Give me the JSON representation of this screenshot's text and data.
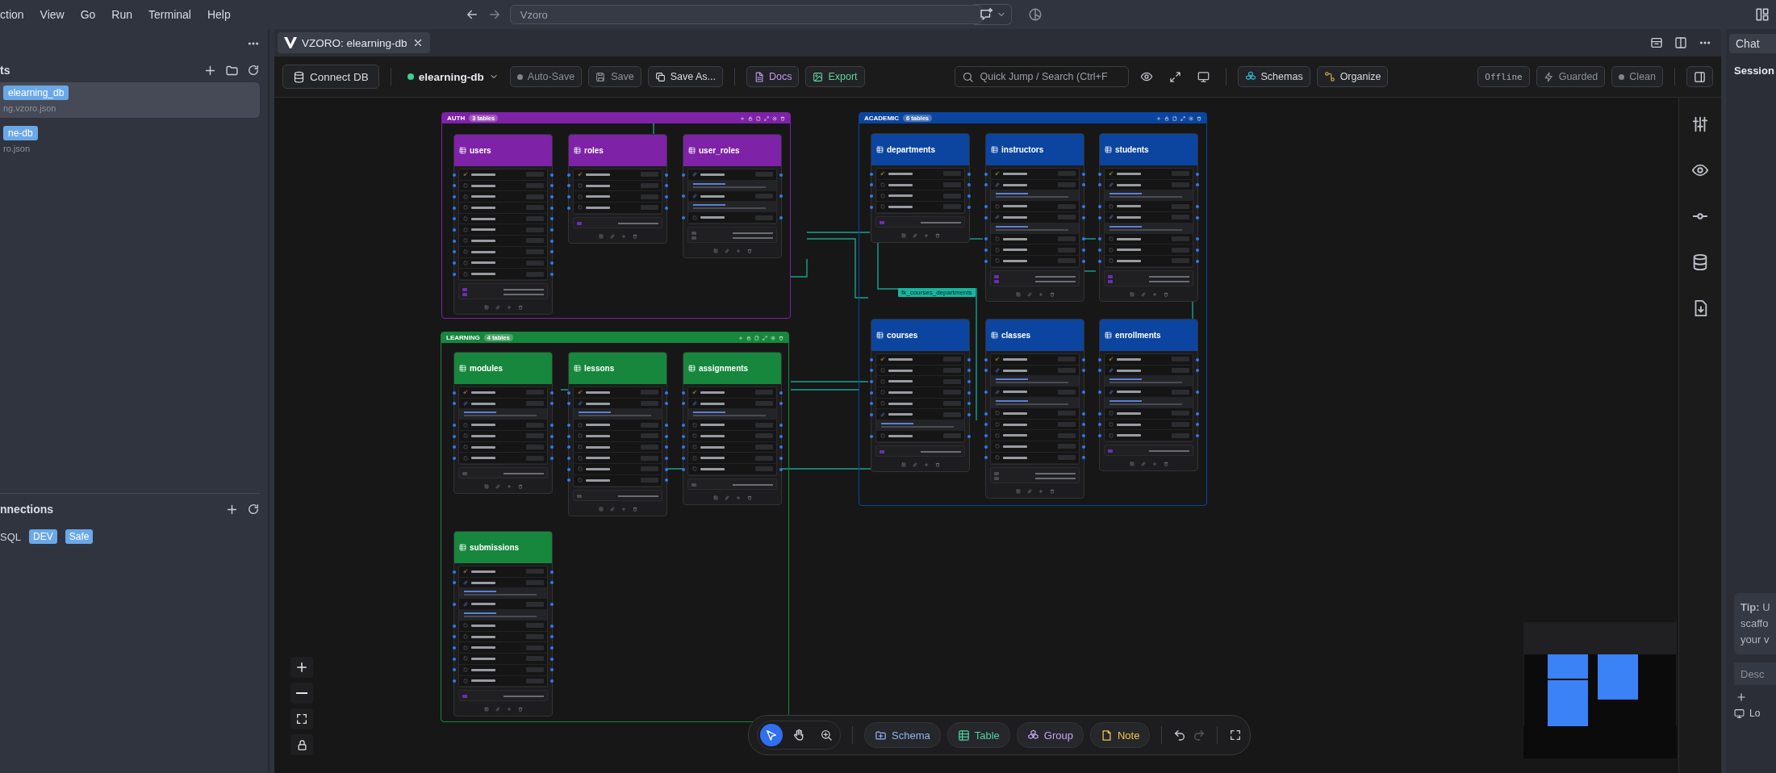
{
  "menu": [
    "ction",
    "View",
    "Go",
    "Run",
    "Terminal",
    "Help"
  ],
  "command_center": {
    "value": "Vzoro"
  },
  "sidebar": {
    "section_title": "ts",
    "projects": [
      {
        "name": "elearning_db",
        "file": "ng.vzoro.json",
        "selected": true
      },
      {
        "name": "ne-db",
        "file": "ro.json",
        "selected": false
      }
    ],
    "connections_title": "nnections",
    "connections": [
      {
        "name": "SQL",
        "tags": [
          "DEV",
          "Safe"
        ]
      }
    ]
  },
  "editor_tab": {
    "title": "VZORO: elearning-db"
  },
  "toolbar": {
    "connect": "Connect DB",
    "project": "elearning-db",
    "autosave": "Auto-Save",
    "save": "Save",
    "save_as": "Save As...",
    "docs": "Docs",
    "export": "Export",
    "search_placeholder": "Quick Jump / Search (Ctrl+F",
    "schemas": "Schemas",
    "organize": "Organize",
    "mode": "Offline",
    "guard": "Guarded",
    "status": "Clean"
  },
  "canvas": {
    "groups": [
      {
        "name": "AUTH",
        "count": "3 tables",
        "color": "#7e22a8",
        "tables": [
          {
            "name": "users",
            "columns": [
              {
                "kind": "pk"
              },
              {
                "kind": "field"
              },
              {
                "kind": "field"
              },
              {
                "kind": "field"
              },
              {
                "kind": "field"
              },
              {
                "kind": "field"
              },
              {
                "kind": "field"
              },
              {
                "kind": "field"
              },
              {
                "kind": "field"
              },
              {
                "kind": "field"
              }
            ],
            "indexes": [
              {
                "kind": "unique"
              },
              {
                "kind": "unique"
              }
            ]
          },
          {
            "name": "roles",
            "columns": [
              {
                "kind": "pk"
              },
              {
                "kind": "field"
              },
              {
                "kind": "field"
              },
              {
                "kind": "field"
              }
            ],
            "indexes": [
              {
                "kind": "unique"
              }
            ]
          },
          {
            "name": "user_roles",
            "columns": [
              {
                "kind": "fk"
              },
              {
                "kind": "fk"
              },
              {
                "kind": "field"
              }
            ],
            "indexes": [
              {
                "kind": "index"
              },
              {
                "kind": "index"
              }
            ]
          }
        ]
      },
      {
        "name": "ACADEMIC",
        "count": "6 tables",
        "color": "#0b45a0",
        "tables": [
          {
            "name": "departments",
            "columns": [
              {
                "kind": "pk"
              },
              {
                "kind": "field"
              },
              {
                "kind": "field"
              },
              {
                "kind": "field"
              }
            ],
            "indexes": [
              {
                "kind": "unique"
              }
            ]
          },
          {
            "name": "instructors",
            "columns": [
              {
                "kind": "pk"
              },
              {
                "kind": "fk"
              },
              {
                "kind": "field"
              },
              {
                "kind": "fk"
              },
              {
                "kind": "field"
              },
              {
                "kind": "field"
              },
              {
                "kind": "field"
              }
            ],
            "indexes": [
              {
                "kind": "unique"
              },
              {
                "kind": "unique"
              }
            ]
          },
          {
            "name": "students",
            "columns": [
              {
                "kind": "pk"
              },
              {
                "kind": "fk"
              },
              {
                "kind": "field"
              },
              {
                "kind": "fk"
              },
              {
                "kind": "field"
              },
              {
                "kind": "field"
              },
              {
                "kind": "field"
              }
            ],
            "indexes": [
              {
                "kind": "unique"
              },
              {
                "kind": "unique"
              }
            ]
          },
          {
            "name": "courses",
            "columns": [
              {
                "kind": "pk"
              },
              {
                "kind": "field"
              },
              {
                "kind": "field"
              },
              {
                "kind": "field"
              },
              {
                "kind": "field"
              },
              {
                "kind": "fk"
              },
              {
                "kind": "field"
              }
            ],
            "indexes": [
              {
                "kind": "unique"
              }
            ]
          },
          {
            "name": "classes",
            "columns": [
              {
                "kind": "pk"
              },
              {
                "kind": "fk"
              },
              {
                "kind": "fk"
              },
              {
                "kind": "field"
              },
              {
                "kind": "field"
              },
              {
                "kind": "field"
              },
              {
                "kind": "field"
              },
              {
                "kind": "field"
              }
            ],
            "indexes": [
              {
                "kind": "index"
              },
              {
                "kind": "index"
              }
            ]
          },
          {
            "name": "enrollments",
            "columns": [
              {
                "kind": "pk"
              },
              {
                "kind": "fk"
              },
              {
                "kind": "fk"
              },
              {
                "kind": "field"
              },
              {
                "kind": "field"
              },
              {
                "kind": "field"
              }
            ],
            "indexes": [
              {
                "kind": "unique"
              }
            ]
          }
        ]
      },
      {
        "name": "LEARNING",
        "count": "4 tables",
        "color": "#16873c",
        "tables": [
          {
            "name": "modules",
            "columns": [
              {
                "kind": "pk"
              },
              {
                "kind": "fk"
              },
              {
                "kind": "field"
              },
              {
                "kind": "field"
              },
              {
                "kind": "field"
              },
              {
                "kind": "field"
              }
            ],
            "indexes": [
              {
                "kind": "index"
              }
            ]
          },
          {
            "name": "lessons",
            "columns": [
              {
                "kind": "pk"
              },
              {
                "kind": "fk"
              },
              {
                "kind": "field"
              },
              {
                "kind": "field"
              },
              {
                "kind": "field"
              },
              {
                "kind": "field"
              },
              {
                "kind": "field"
              },
              {
                "kind": "field"
              }
            ],
            "indexes": [
              {
                "kind": "index"
              }
            ]
          },
          {
            "name": "assignments",
            "columns": [
              {
                "kind": "pk"
              },
              {
                "kind": "fk"
              },
              {
                "kind": "field"
              },
              {
                "kind": "field"
              },
              {
                "kind": "field"
              },
              {
                "kind": "field"
              },
              {
                "kind": "field"
              }
            ],
            "indexes": [
              {
                "kind": "index"
              }
            ]
          },
          {
            "name": "submissions",
            "columns": [
              {
                "kind": "pk"
              },
              {
                "kind": "fk"
              },
              {
                "kind": "fk"
              },
              {
                "kind": "field"
              },
              {
                "kind": "field"
              },
              {
                "kind": "field"
              },
              {
                "kind": "field"
              },
              {
                "kind": "field"
              },
              {
                "kind": "field"
              }
            ],
            "indexes": [
              {
                "kind": "unique"
              }
            ]
          }
        ]
      }
    ],
    "relations": [
      {
        "label": "fk_courses_departments"
      }
    ]
  },
  "canvas_tools": {
    "modes": [
      {
        "kind": "select",
        "selected": true
      },
      {
        "kind": "hand",
        "selected": false
      },
      {
        "kind": "zoom",
        "selected": false
      }
    ],
    "adders": [
      {
        "kind": "schema",
        "label": "Schema"
      },
      {
        "kind": "table",
        "label": "Table"
      },
      {
        "kind": "group",
        "label": "Group"
      },
      {
        "kind": "note",
        "label": "Note"
      }
    ],
    "undo_disabled": false,
    "redo_disabled": true
  },
  "chat": {
    "tab": "Chat",
    "section": "Session",
    "tip_lines": [
      "**Tip:** U",
      "scaffo",
      "your v"
    ],
    "input_placeholder": "Desc",
    "footer": "Lo"
  }
}
